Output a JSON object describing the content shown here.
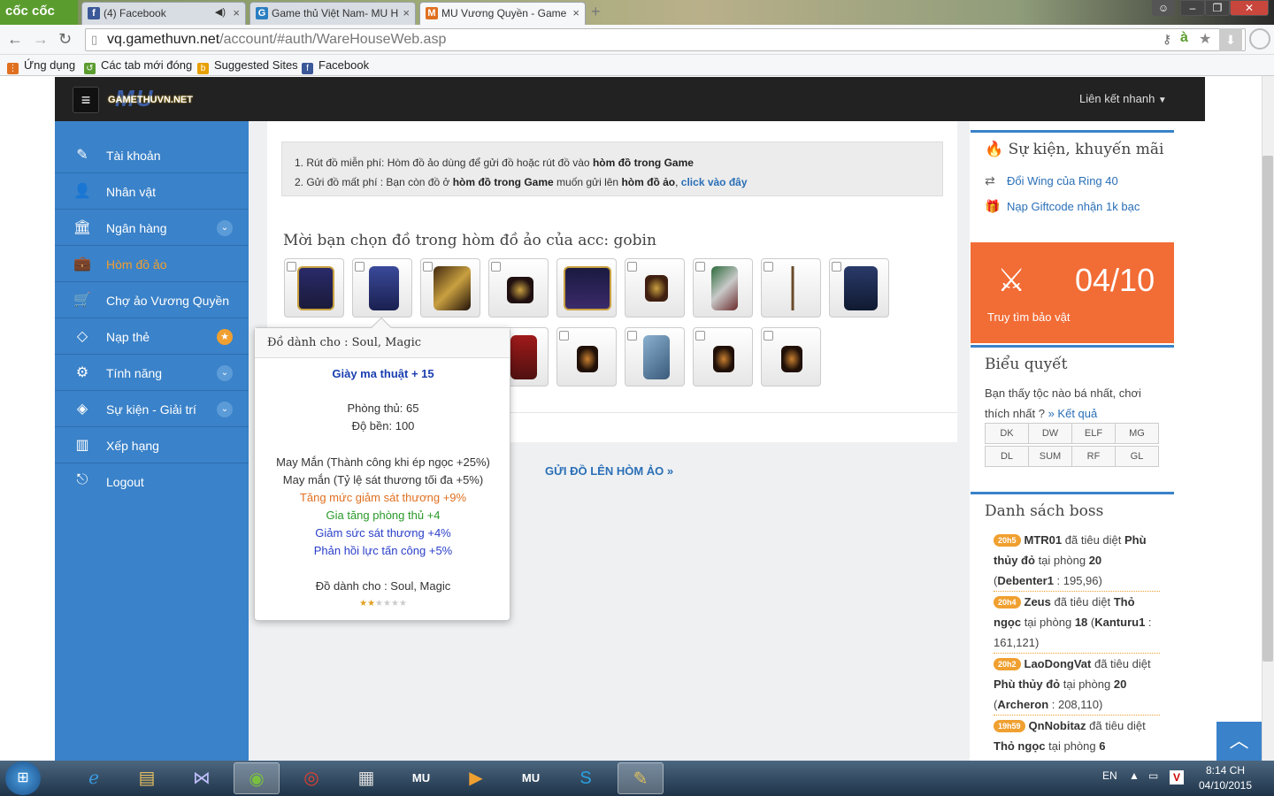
{
  "browser": {
    "logo": "cốc cốc",
    "tabs": [
      {
        "label": "(4) Facebook",
        "icon": "facebook-icon"
      },
      {
        "label": "Game thủ Việt Nam- MU H",
        "icon": "gamethu-icon"
      },
      {
        "label": "MU Vương Quyền - Game",
        "icon": "mu-icon"
      }
    ],
    "url_domain": "vq.gamethuvn.net",
    "url_path": "/account/#auth/WareHouseWeb.asp",
    "bookmarks": [
      "Ứng dụng",
      "Các tab mới đóng",
      "Suggested Sites",
      "Facebook"
    ],
    "accent": "#5b9c2f"
  },
  "header": {
    "brand_main": "MU",
    "brand_sub": "GAMETHUVN.NET",
    "quick_links": "Liên kết nhanh"
  },
  "sidebar": {
    "accent": "#3a82c9",
    "active_color": "#f0a030",
    "items": [
      {
        "label": "Tài khoản",
        "icon": "edit-icon"
      },
      {
        "label": "Nhân vật",
        "icon": "user-icon"
      },
      {
        "label": "Ngân hàng",
        "icon": "bank-icon"
      },
      {
        "label": "Hòm đồ ảo",
        "icon": "briefcase-icon"
      },
      {
        "label": "Chợ ảo Vương Quyền",
        "icon": "cart-icon"
      },
      {
        "label": "Nạp thẻ",
        "icon": "diamond-icon"
      },
      {
        "label": "Tính năng",
        "icon": "cogs-icon"
      },
      {
        "label": "Sự kiện - Giải trí",
        "icon": "events-icon"
      },
      {
        "label": "Xếp hạng",
        "icon": "chart-icon"
      },
      {
        "label": "Logout",
        "icon": "logout-icon"
      }
    ]
  },
  "main": {
    "info_line1_prefix": "1. Rút đồ miễn phí: Hòm đồ ảo dùng để gửi đồ hoặc rút đồ vào",
    "info_line1_bold": "hòm đồ trong Game",
    "info_line2_prefix": "2. Gửi đồ mất phí : Bạn còn đồ ở",
    "info_line2_bold1": "hòm đồ trong Game",
    "info_line2_mid": "muốn gửi lên",
    "info_line2_bold2": "hòm đồ ảo",
    "info_line2_link": "click vào đây",
    "choose_title": "Mời bạn chọn đồ trong hòm đồ ảo của acc: gobin",
    "send_link": "GỬI ĐỒ LÊN HÒM ẢO  »"
  },
  "tooltip": {
    "header": "Đồ dành cho : Soul, Magic",
    "name": "Giày ma thuật  + 15",
    "defense": "Phòng thủ: 65",
    "durability": "Độ bền: 100",
    "luck1": "May Mắn (Thành công khi ép ngọc +25%)",
    "luck2": "May mắn (Tỷ lệ sát thương tối đa +5%)",
    "opt_orange": "Tăng mức giảm sát thương +9%",
    "opt_green": "Gia tăng phòng thủ +4",
    "opt_blue1": "Giảm sức sát thương +4%",
    "opt_blue2": "Phản hồi lực tấn công +5%",
    "for_class": "Đồ dành cho : Soul, Magic",
    "rating": 2,
    "rating_max": 6
  },
  "events": {
    "title": "Sự kiện, khuyến mãi",
    "links": [
      "Đổi Wing của Ring 40",
      "Nạp Giftcode nhận 1k bạc"
    ]
  },
  "treasure": {
    "date": "04/10",
    "label": "Truy tìm bảo vật",
    "color": "#f26c35"
  },
  "poll": {
    "title": "Biểu quyết",
    "text": "Bạn thấy tộc nào bá nhất, chơi thích nhất ?",
    "result_link": "» Kết quả",
    "classes": [
      "DK",
      "DW",
      "ELF",
      "MG",
      "DL",
      "SUM",
      "RF",
      "GL"
    ]
  },
  "bosses": {
    "title": "Danh sách boss",
    "entries": [
      {
        "time": "20h5",
        "player": "MTR01",
        "verb": "đã tiêu diệt",
        "boss": "Phù thủy đỏ",
        "room_prefix": "tại phòng",
        "room": "20",
        "map": "Debenter1",
        "coords": " : 195,96)"
      },
      {
        "time": "20h4",
        "player": "Zeus",
        "verb": "đã tiêu diệt",
        "boss": "Thỏ ngọc",
        "room_prefix": "tại phòng",
        "room": "18",
        "map": "Kanturu1",
        "coords": " : 161,121)"
      },
      {
        "time": "20h2",
        "player": "LaoDongVat",
        "verb": "đã tiêu diệt",
        "boss": "Phù thủy đỏ",
        "room_prefix": "tại phòng",
        "room": "20",
        "map": "Archeron",
        "coords": " : 208,110)"
      },
      {
        "time": "19h59",
        "player": "QnNobitaz",
        "verb": "đã tiêu diệt",
        "boss": "Thỏ ngọc",
        "room_prefix": "tại phòng",
        "room": "6",
        "map": "",
        "coords": ""
      }
    ]
  },
  "taskbar": {
    "lang": "EN",
    "time": "8:14 CH",
    "date": "04/10/2015"
  }
}
